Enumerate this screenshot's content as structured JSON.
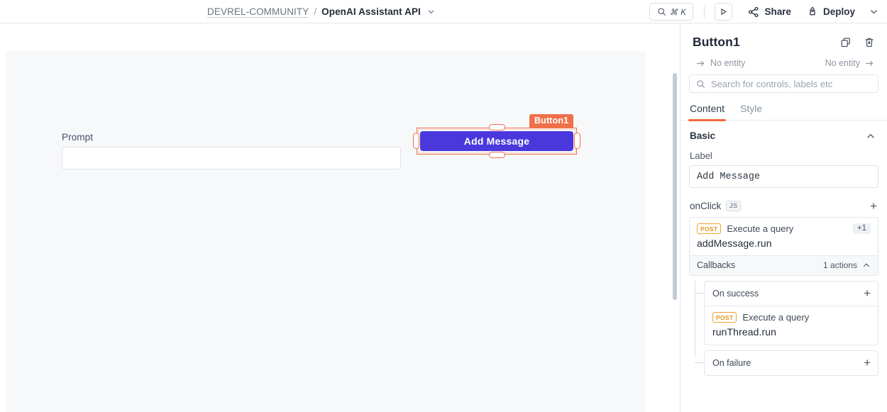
{
  "header": {
    "breadcrumb": {
      "org": "DEVREL-COMMUNITY",
      "separator": "/",
      "app": "OpenAI Assistant API",
      "chevron_icon": "chevron-down-icon"
    },
    "search": {
      "icon": "search-icon",
      "shortcut": "⌘ K"
    },
    "preview_button": {
      "icon": "play-icon"
    },
    "share": {
      "icon": "share-nodes-icon",
      "label": "Share"
    },
    "deploy": {
      "icon": "rocket-icon",
      "label": "Deploy",
      "chevron_icon": "chevron-down-icon"
    }
  },
  "canvas": {
    "prompt_widget": {
      "label": "Prompt",
      "value": "",
      "placeholder": ""
    },
    "button_widget": {
      "name_tag": "Button1",
      "label": "Add Message",
      "fill_color": "#4a38dc",
      "selection_color": "#ef7049",
      "selected": true
    }
  },
  "panel": {
    "title": "Button1",
    "copy_icon": "copy-icon",
    "delete_icon": "trash-icon",
    "entity": {
      "prev_arrow_icon": "arrow-right-icon",
      "prev_label": "No entity",
      "next_label": "No entity",
      "next_arrow_icon": "arrow-right-icon"
    },
    "search": {
      "icon": "search-icon",
      "placeholder": "Search for controls, labels etc",
      "value": ""
    },
    "tabs": [
      {
        "label": "Content",
        "active": true
      },
      {
        "label": "Style",
        "active": false
      }
    ],
    "basic_section": {
      "title": "Basic",
      "collapse_icon": "chevron-up-icon",
      "label_field": {
        "label": "Label",
        "value": "Add Message"
      },
      "onclick": {
        "label": "onClick",
        "js_badge": "JS",
        "add_icon": "+",
        "action": {
          "method_badge": "POST",
          "kind": "Execute a query",
          "extra_badge": "+1",
          "name": "addMessage.run"
        },
        "callbacks": {
          "label": "Callbacks",
          "count_label": "1 actions",
          "collapse_icon": "chevron-up-icon",
          "on_success": {
            "title": "On success",
            "add_icon": "+",
            "action": {
              "method_badge": "POST",
              "kind": "Execute a query",
              "name": "runThread.run"
            }
          },
          "on_failure": {
            "title": "On failure",
            "add_icon": "+"
          }
        }
      }
    }
  }
}
